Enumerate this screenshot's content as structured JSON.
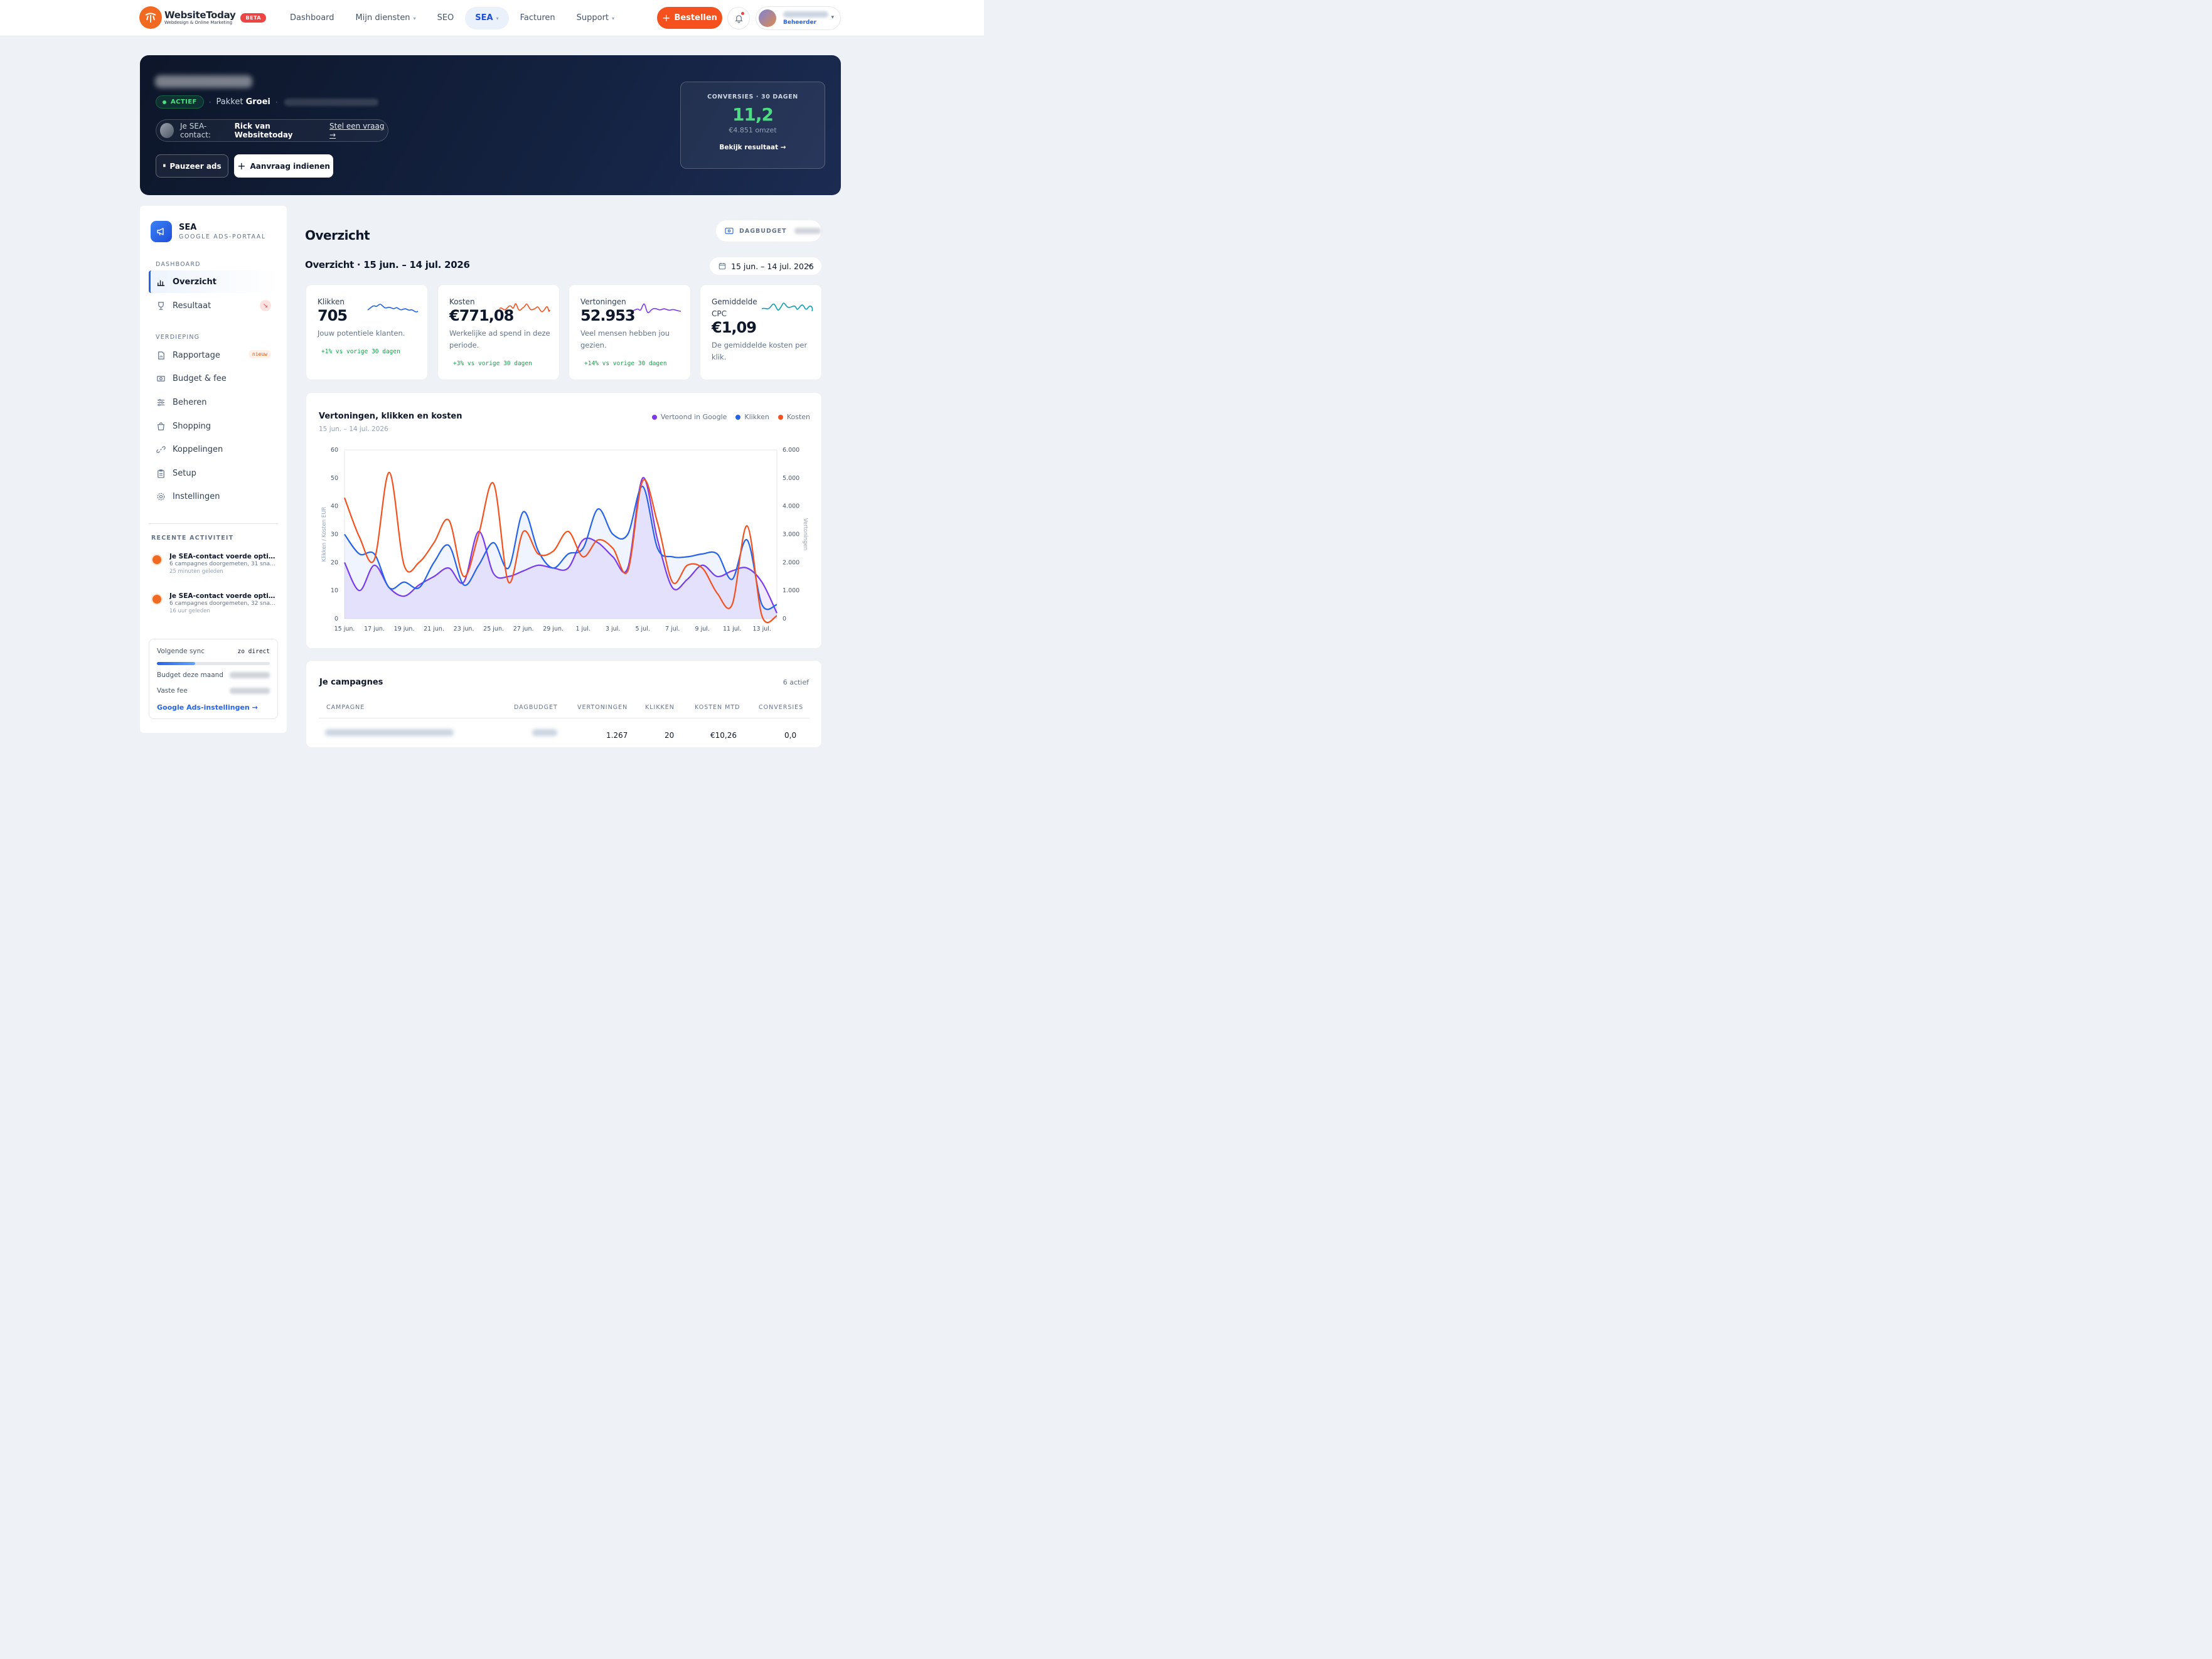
{
  "brand": {
    "name": "WebsiteToday",
    "tagline": "Webdesign & Online Marketing",
    "beta": "BETA",
    "accent": "#f4511e"
  },
  "nav": {
    "items": [
      {
        "label": "Dashboard",
        "caret": ""
      },
      {
        "label": "Mijn diensten",
        "caret": "▾"
      },
      {
        "label": "SEO",
        "caret": ""
      },
      {
        "label": "SEA",
        "caret": "▾"
      },
      {
        "label": "Facturen",
        "caret": ""
      },
      {
        "label": "Support",
        "caret": "▾"
      }
    ],
    "active": "SEA",
    "order_label": "Bestellen",
    "order_plus": "+",
    "user_role": "Beheerder",
    "user_caret": "▾"
  },
  "hero": {
    "status": "ACTIEF",
    "sep": "·",
    "package_prefix": "Pakket",
    "package_name": "Groei",
    "contact_prefix": "Je SEA-contact:",
    "contact_name": "Rick van Websitetoday",
    "contact_link": "Stel een vraag →",
    "pause_icon": "⏸",
    "pause_label": "Pauzeer ads",
    "request_plus": "+",
    "request_label": "Aanvraag indienen",
    "conversions_label": "CONVERSIES · 30 DAGEN",
    "conversions_value": "11,2",
    "revenue": "€4.851 omzet",
    "result_link": "Bekijk resultaat →"
  },
  "sidebar": {
    "title": "SEA",
    "subtitle": "GOOGLE ADS-PORTAAL",
    "section_dashboard": "DASHBOARD",
    "section_deep": "VERDIEPING",
    "items": [
      {
        "label": "Overzicht",
        "icon": "bar-chart-icon"
      },
      {
        "label": "Resultaat",
        "icon": "trophy-icon",
        "badge": "↘"
      },
      {
        "label": "Rapportage",
        "icon": "report-icon",
        "badge": "nieuw"
      },
      {
        "label": "Budget & fee",
        "icon": "money-icon"
      },
      {
        "label": "Beheren",
        "icon": "sliders-icon"
      },
      {
        "label": "Shopping",
        "icon": "shopping-bag-icon"
      },
      {
        "label": "Koppelingen",
        "icon": "link-icon"
      },
      {
        "label": "Setup",
        "icon": "clipboard-icon"
      },
      {
        "label": "Instellingen",
        "icon": "gear-icon"
      }
    ],
    "recent_title": "RECENTE ACTIVITEIT",
    "activities": [
      {
        "title": "Je SEA-contact voerde optimalisaties uit",
        "sub": "6 campagnes doorgemeten, 31 snapshots",
        "time": "25 minuten geleden"
      },
      {
        "title": "Je SEA-contact voerde optimalisaties uit",
        "sub": "6 campagnes doorgemeten, 32 snapshots",
        "time": "16 uur geleden"
      }
    ],
    "sync_label": "Volgende sync",
    "sync_value": "zo direct",
    "sync_progress": 0.34,
    "budget_label": "Budget deze maand",
    "fee_label": "Vaste fee",
    "settings_link": "Google Ads-instellingen →"
  },
  "main": {
    "title": "Overzicht",
    "budget_label": "DAGBUDGET",
    "period_title": "Overzicht · 15 jun. – 14 jul. 2026",
    "date_range": "15 jun. – 14 jul. 2026",
    "kpis": [
      {
        "label": "Klikken",
        "value": "705",
        "desc": "Jouw potentiele klanten.",
        "delta": "+1% vs vorige 30 dagen",
        "color": "#2563eb"
      },
      {
        "label": "Kosten",
        "value": "€771,08",
        "desc": "Werkelijke ad spend in deze periode.",
        "delta": "+3% vs vorige 30 dagen",
        "color": "#f4511e"
      },
      {
        "label": "Vertoningen",
        "value": "52.953",
        "desc": "Veel mensen hebben jou gezien.",
        "delta": "+14% vs vorige 30 dagen",
        "color": "#7c3aed"
      },
      {
        "label": "Gemiddelde CPC",
        "value": "€1,09",
        "desc": "De gemiddelde kosten per klik.",
        "delta": "",
        "color": "#0e9fb5"
      }
    ],
    "campaigns": {
      "title": "Je campagnes",
      "count": "6 actief",
      "columns": [
        "CAMPAGNE",
        "DAGBUDGET",
        "VERTONINGEN",
        "KLIKKEN",
        "KOSTEN MTD",
        "CONVERSIES"
      ],
      "first_row": {
        "impressions": "1.267",
        "clicks": "20",
        "cost": "€10,26",
        "conversions": "0,0"
      }
    }
  },
  "chart_data": {
    "type": "line",
    "title": "Vertoningen, klikken en kosten",
    "subtitle": "15 jun. – 14 jul. 2026",
    "ylabel": "Klikken / Kosten EUR",
    "y2label": "Vertoningen",
    "ylim": [
      0,
      60
    ],
    "y2lim": [
      0,
      6000
    ],
    "yticks": [
      "0",
      "10",
      "20",
      "30",
      "40",
      "50",
      "60"
    ],
    "y2ticks": [
      "0",
      "1.000",
      "2.000",
      "3.000",
      "4.000",
      "5.000",
      "6.000"
    ],
    "categories": [
      "15 jun.",
      "16 jun.",
      "17 jun.",
      "18 jun.",
      "19 jun.",
      "20 jun.",
      "21 jun.",
      "22 jun.",
      "23 jun.",
      "24 jun.",
      "25 jun.",
      "26 jun.",
      "27 jun.",
      "28 jun.",
      "29 jun.",
      "30 jun.",
      "1 jul.",
      "2 jul.",
      "3 jul.",
      "4 jul.",
      "5 jul.",
      "6 jul.",
      "7 jul.",
      "8 jul.",
      "9 jul.",
      "10 jul.",
      "11 jul.",
      "12 jul.",
      "13 jul.",
      "14 jul."
    ],
    "xtick_labels": [
      "15 jun.",
      "17 jun.",
      "19 jun.",
      "21 jun.",
      "23 jun.",
      "25 jun.",
      "27 jun.",
      "29 jun.",
      "1 jul.",
      "3 jul.",
      "5 jul.",
      "7 jul.",
      "9 jul.",
      "11 jul.",
      "13 jul."
    ],
    "legend_position": "top-right",
    "series": [
      {
        "name": "Vertoond in Google",
        "axis": "right",
        "color": "#7c3aed",
        "values": [
          2000,
          1000,
          1900,
          1100,
          800,
          1200,
          1500,
          1800,
          1300,
          3100,
          1600,
          1500,
          1700,
          1900,
          1800,
          1800,
          2800,
          2700,
          2200,
          1800,
          5000,
          2800,
          1100,
          1400,
          1900,
          1500,
          1700,
          1800,
          1300,
          200
        ]
      },
      {
        "name": "Klikken",
        "axis": "left",
        "color": "#2563eb",
        "values": [
          30,
          23,
          23,
          11,
          13,
          11,
          20,
          26,
          12,
          19,
          27,
          18,
          38,
          24,
          18,
          23,
          25,
          39,
          30,
          30,
          47,
          25,
          22,
          22,
          23,
          23,
          14,
          28,
          5,
          5
        ]
      },
      {
        "name": "Kosten",
        "axis": "left",
        "color": "#f4511e",
        "values": [
          43,
          29,
          21,
          52,
          19,
          20,
          27,
          35,
          15,
          30,
          48,
          13,
          31,
          23,
          24,
          31,
          22,
          28,
          25,
          17,
          49,
          34,
          13,
          19,
          18,
          9,
          5,
          33,
          1,
          1
        ]
      }
    ]
  }
}
